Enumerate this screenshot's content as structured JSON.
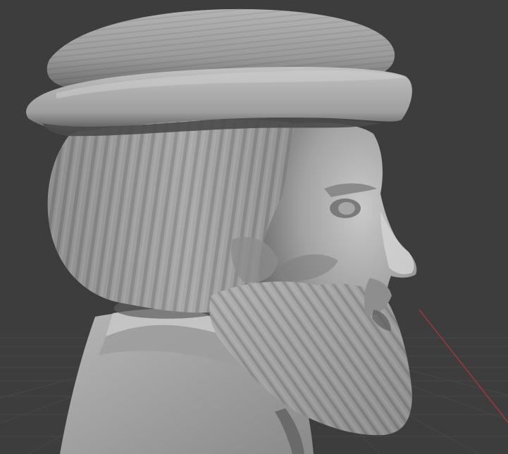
{
  "viewport": {
    "background_color": "#3d3d3d",
    "grid_line_color": "#4a4a4a",
    "x_axis_color": "#c0404a",
    "mesh_base_color": "#9a9a9a",
    "mesh_highlight_color": "#c8c8c8",
    "mesh_shadow_color": "#5a5a5a",
    "object": {
      "icon": "bust-sculpt-mesh",
      "description_visible_text": ""
    }
  }
}
